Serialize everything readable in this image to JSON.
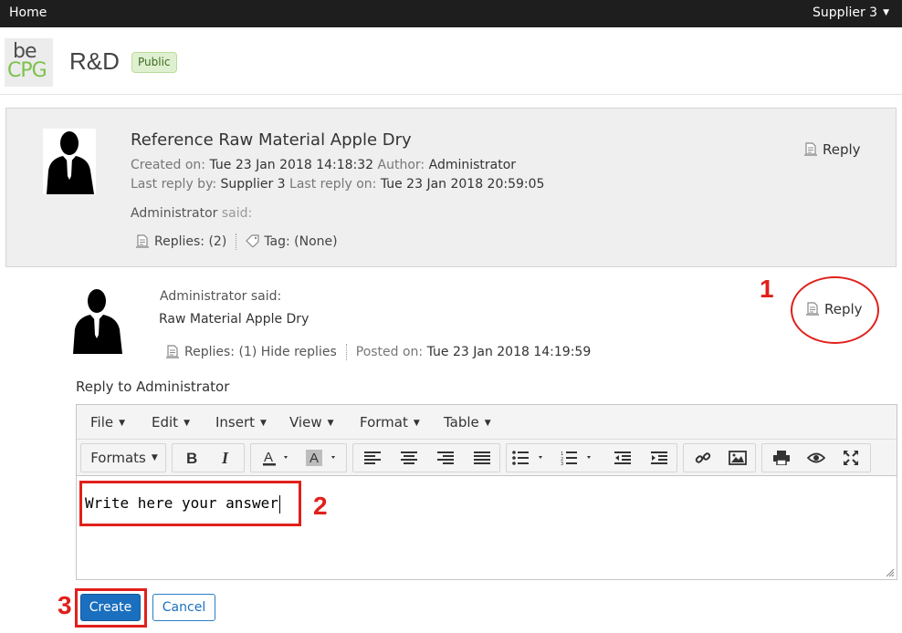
{
  "topbar": {
    "home": "Home",
    "user": "Supplier 3"
  },
  "site": {
    "logo_top": "be",
    "logo_bottom": "CPG",
    "title": "R&D",
    "visibility": "Public"
  },
  "topic": {
    "title": "Reference Raw Material Apple Dry",
    "created_label": "Created on:",
    "created_value": "Tue 23 Jan 2018 14:18:32",
    "author_label": "Author:",
    "author_value": "Administrator",
    "lastreply_label": "Last reply by:",
    "lastreply_value": "Supplier 3",
    "lastreplyon_label": "Last reply on:",
    "lastreplyon_value": "Tue 23 Jan 2018 20:59:05",
    "said_author": "Administrator",
    "said_word": "said:",
    "replies": "Replies: (2)",
    "tag_label": "Tag:",
    "tag_value": "(None)",
    "reply": "Reply"
  },
  "entry": {
    "said": "Administrator said:",
    "body": "Raw Material Apple Dry",
    "replies": "Replies: (1) Hide replies",
    "posted_label": "Posted on:",
    "posted_value": "Tue 23 Jan 2018 14:19:59",
    "reply": "Reply"
  },
  "annotations": {
    "one": "1",
    "two": "2",
    "three": "3"
  },
  "reply_to": "Reply to Administrator",
  "editor": {
    "menus": [
      "File",
      "Edit",
      "Insert",
      "View",
      "Format",
      "Table"
    ],
    "formats": "Formats",
    "content": "Write here your answer"
  },
  "actions": {
    "create": "Create",
    "cancel": "Cancel"
  },
  "colors": {
    "accent": "#1a6fbf",
    "annotation": "#e0201b",
    "badge": "#dff0d0"
  }
}
